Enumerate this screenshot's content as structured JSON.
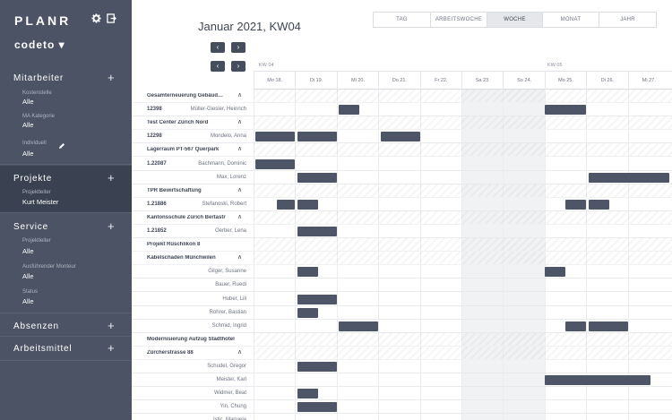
{
  "app": {
    "brand": "PLANR",
    "workspace": "codeto ▾",
    "icons": [
      "gear-icon",
      "logout-icon"
    ]
  },
  "sidebar": {
    "sections": [
      {
        "id": "mitarbeiter",
        "label": "Mitarbeiter",
        "filters": [
          {
            "label": "Kostenstelle",
            "value": "Alle"
          },
          {
            "label": "MA Kategorie",
            "value": "Alle"
          },
          {
            "label": "Individuell",
            "value": "Alle"
          }
        ]
      },
      {
        "id": "projekte",
        "label": "Projekte",
        "filters": [
          {
            "label": "Projektleiter",
            "value": "Kurt Meister"
          }
        ]
      },
      {
        "id": "service",
        "label": "Service",
        "filters": [
          {
            "label": "Projektleiter",
            "value": "Alle"
          },
          {
            "label": "Ausführender Monteur",
            "value": "Alle"
          },
          {
            "label": "Status",
            "value": "Alle"
          }
        ]
      },
      {
        "id": "absenzen",
        "label": "Absenzen",
        "filters": []
      },
      {
        "id": "arbeitsmittel",
        "label": "Arbeitsmittel",
        "filters": []
      }
    ]
  },
  "header": {
    "title": "Januar 2021, KW04",
    "nav_prev": "‹",
    "nav_next": "›",
    "tabs": [
      "TAG",
      "ARBEITSWOCHE",
      "WOCHE",
      "MONAT",
      "JAHR"
    ],
    "active_tab": "WOCHE"
  },
  "calendar": {
    "weeks": [
      {
        "label": "KW 04"
      },
      {
        "label": "KW 05"
      }
    ],
    "days": [
      "Mo 18.",
      "Di 19.",
      "Mi 20.",
      "Do 21.",
      "Fr 22.",
      "Sa 23.",
      "So 24.",
      "Mo 25.",
      "Di 26.",
      "Mi 27."
    ],
    "weekend_days": [
      5,
      6
    ],
    "rows": [
      {
        "kind": "project",
        "name": "Gesamterneuerung Gebäud…",
        "caret": "∧",
        "bars": []
      },
      {
        "kind": "task",
        "id": "12398",
        "name": "Müller-Giesler, Heinrich",
        "bars": [
          [
            2.05,
            2.55
          ],
          [
            7.0,
            8.0
          ]
        ]
      },
      {
        "kind": "project",
        "name": "Test Center Zürich Nord",
        "caret": "∧",
        "bars": []
      },
      {
        "kind": "task",
        "id": "12298",
        "name": "Mondelo, Anna",
        "bars": [
          [
            0.05,
            1.0
          ],
          [
            1.05,
            2.0
          ],
          [
            3.05,
            4.0
          ]
        ]
      },
      {
        "kind": "project",
        "name": "Lagerraum PT-567 Querpark",
        "caret": "∧",
        "bars": []
      },
      {
        "kind": "task",
        "id": "1.22087",
        "name": "Bachmann, Dominic",
        "bars": [
          [
            0.05,
            1.0
          ]
        ]
      },
      {
        "kind": "task",
        "id": "",
        "name": "Max, Lorenz",
        "bars": [
          [
            1.05,
            2.0
          ],
          [
            8.05,
            10.0
          ]
        ]
      },
      {
        "kind": "project",
        "name": "TPR Bewirtschaftung",
        "caret": "∧",
        "bars": []
      },
      {
        "kind": "task",
        "id": "1.21886",
        "name": "Stefanoski, Robert",
        "bars": [
          [
            0.55,
            1.0
          ],
          [
            1.05,
            1.55
          ],
          [
            7.5,
            8.0
          ],
          [
            8.05,
            8.55
          ]
        ]
      },
      {
        "kind": "project",
        "name": "Kantonsschule Zürich Bertastr",
        "caret": "∧",
        "bars": []
      },
      {
        "kind": "task",
        "id": "1.21852",
        "name": "Oerber, Lena",
        "bars": [
          [
            1.05,
            2.0
          ]
        ]
      },
      {
        "kind": "project",
        "name": "Projekt Rüschlikon 8",
        "caret": "",
        "bars": []
      },
      {
        "kind": "project",
        "name": "Kabelschaden Münchwilen",
        "caret": "∧",
        "bars": []
      },
      {
        "kind": "task",
        "id": "",
        "name": "Gilger, Susanne",
        "bars": [
          [
            1.05,
            1.55
          ],
          [
            7.0,
            7.5
          ]
        ]
      },
      {
        "kind": "task",
        "id": "",
        "name": "Bauer, Ruedi",
        "bars": []
      },
      {
        "kind": "task",
        "id": "",
        "name": "Huber, Lili",
        "bars": [
          [
            1.05,
            2.0
          ]
        ]
      },
      {
        "kind": "task",
        "id": "",
        "name": "Rohrer, Bastian",
        "bars": [
          [
            1.05,
            1.55
          ]
        ]
      },
      {
        "kind": "task",
        "id": "",
        "name": "Schmid, Ingrid",
        "bars": [
          [
            2.05,
            3.0
          ],
          [
            7.5,
            8.0
          ],
          [
            8.05,
            9.0
          ]
        ]
      },
      {
        "kind": "project",
        "name": "Modernisierung Aufzug Stadthotel",
        "caret": "",
        "bars": []
      },
      {
        "kind": "project",
        "name": "Zürcherstrasse 88",
        "caret": "∧",
        "bars": []
      },
      {
        "kind": "task",
        "id": "",
        "name": "Schudel, Gregor",
        "bars": [
          [
            1.05,
            2.0
          ]
        ]
      },
      {
        "kind": "task",
        "id": "",
        "name": "Meister, Karl",
        "bars": [
          [
            7.0,
            9.55
          ]
        ]
      },
      {
        "kind": "task",
        "id": "",
        "name": "Widmer, Beat",
        "bars": [
          [
            1.05,
            1.55
          ]
        ]
      },
      {
        "kind": "task",
        "id": "",
        "name": "Yin, Chung",
        "bars": [
          [
            1.05,
            2.0
          ]
        ]
      },
      {
        "kind": "task",
        "id": "",
        "name": "Istic, Manuela",
        "bars": []
      }
    ]
  },
  "colors": {
    "sidebar": "#4b5364",
    "bar": "#4d5566",
    "weekend": "#f1f2f4"
  }
}
